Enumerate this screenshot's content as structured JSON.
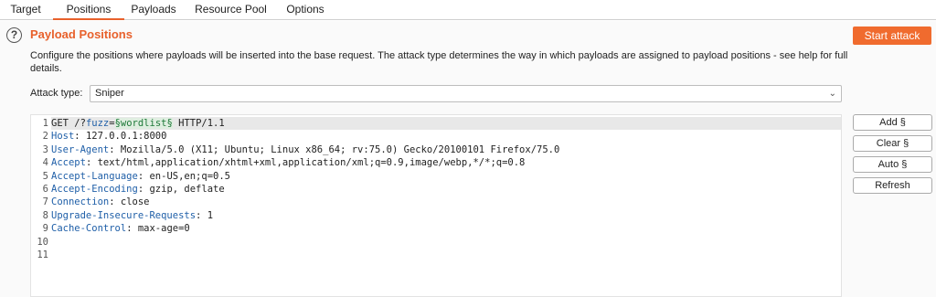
{
  "tabs": [
    "Target",
    "Positions",
    "Payloads",
    "Resource Pool",
    "Options"
  ],
  "header": {
    "help_icon": "?",
    "title": "Payload Positions",
    "start_attack": "Start attack"
  },
  "description": "Configure the positions where payloads will be inserted into the base request. The attack type determines the way in which payloads are assigned to payload positions - see help for full details.",
  "attack_type": {
    "label": "Attack type:",
    "value": "Sniper"
  },
  "request": {
    "line1": {
      "method": "GET /?",
      "param": "fuzz",
      "eq": "=",
      "m1": "§",
      "payload": "wordlist",
      "m2": "§",
      "rest": " HTTP/1.1"
    },
    "headers": [
      {
        "name": "Host",
        "value": " 127.0.0.1:8000"
      },
      {
        "name": "User-Agent",
        "value": " Mozilla/5.0 (X11; Ubuntu; Linux x86_64; rv:75.0) Gecko/20100101 Firefox/75.0"
      },
      {
        "name": "Accept",
        "value": " text/html,application/xhtml+xml,application/xml;q=0.9,image/webp,*/*;q=0.8"
      },
      {
        "name": "Accept-Language",
        "value": " en-US,en;q=0.5"
      },
      {
        "name": "Accept-Encoding",
        "value": " gzip, deflate"
      },
      {
        "name": "Connection",
        "value": " close"
      },
      {
        "name": "Upgrade-Insecure-Requests",
        "value": " 1"
      },
      {
        "name": "Cache-Control",
        "value": " max-age=0"
      }
    ],
    "line_numbers": [
      "1",
      "2",
      "3",
      "4",
      "5",
      "6",
      "7",
      "8",
      "9",
      "10",
      "11"
    ]
  },
  "buttons": {
    "add": "Add §",
    "clear": "Clear §",
    "auto": "Auto §",
    "refresh": "Refresh"
  },
  "colors": {
    "accent": "#e8612c",
    "button": "#f06b2e",
    "header_name": "#1f5fa8",
    "payload_marker": "#1f7a3a"
  }
}
